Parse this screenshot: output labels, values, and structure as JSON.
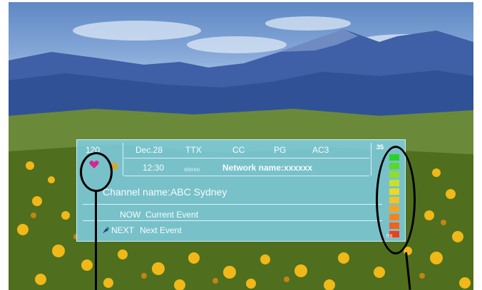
{
  "channel": {
    "number": "120",
    "name": "Channel name:ABC Sydney"
  },
  "info_row": {
    "date": "Dec.28",
    "ttx": "TTX",
    "cc": "CC",
    "rating": "PG",
    "audio": "AC3",
    "time": "12:30",
    "stereo": "stereo",
    "network": "Network name:xxxxxx"
  },
  "events": {
    "now_label": "NOW",
    "now_value": "Current Event",
    "next_label": "NEXT",
    "next_value": "Next Event"
  },
  "signal": {
    "top_value": "35",
    "bottom_value": "ns"
  },
  "meter_colors": [
    "#2bd12b",
    "#58d82b",
    "#8fde2d",
    "#c7e02c",
    "#e9da24",
    "#f4c421",
    "#f7a31f",
    "#f6821e",
    "#f2611d",
    "#ee3f1c"
  ],
  "icons": {
    "favorite": "heart-icon",
    "lock": "lock-icon",
    "satellite": "satellite-icon"
  }
}
